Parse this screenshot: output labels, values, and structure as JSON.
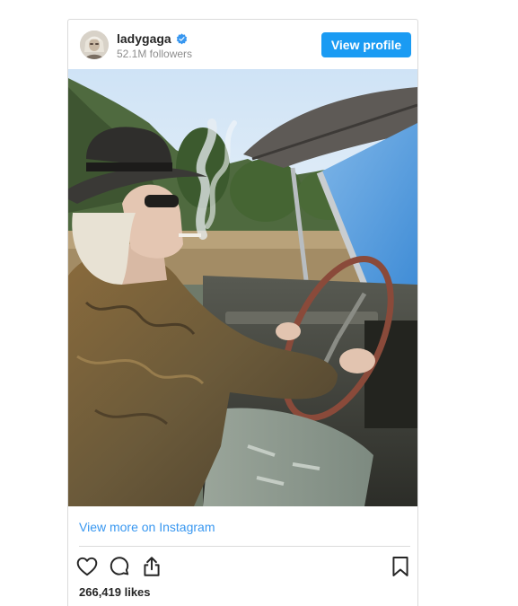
{
  "profile": {
    "username": "ladygaga",
    "followers": "52.1M followers",
    "verified": true,
    "avatar_icon": "profile-avatar"
  },
  "header": {
    "view_profile_label": "View profile"
  },
  "post": {
    "image_alt": "Person in a wide-brimmed hat and sunglasses driving a vintage convertible"
  },
  "footer": {
    "view_more_label": "View more on Instagram",
    "likes": "266,419 likes"
  },
  "icons": {
    "like": "heart-icon",
    "comment": "comment-icon",
    "share": "share-icon",
    "save": "bookmark-icon",
    "verified": "verified-badge-icon"
  },
  "colors": {
    "accent": "#1a9bf3",
    "link": "#3897f0",
    "text": "#262626",
    "muted": "#8e8e8e",
    "border": "#dbdbdb"
  }
}
